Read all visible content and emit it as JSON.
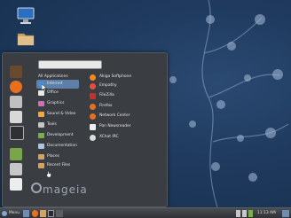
{
  "menu": {
    "search_placeholder": "",
    "header": "All Applications",
    "categories": [
      {
        "label": "Internet",
        "color": "#4a8fd6"
      },
      {
        "label": "Office",
        "color": "#e8e8e8"
      },
      {
        "label": "Graphics",
        "color": "#d16fb5"
      },
      {
        "label": "Sound & Video",
        "color": "#f0a93a"
      },
      {
        "label": "Tools",
        "color": "#c7c7c7"
      },
      {
        "label": "Development",
        "color": "#78b04a"
      },
      {
        "label": "Documentation",
        "color": "#a9c6e6"
      },
      {
        "label": "Places",
        "color": "#d9a25b"
      },
      {
        "label": "Recent Files",
        "color": "#d9a25b"
      }
    ],
    "apps": [
      {
        "label": "Akiga Softphone",
        "color": "#f28a1e"
      },
      {
        "label": "Empathy",
        "color": "#e94e3b"
      },
      {
        "label": "FileZilla",
        "color": "#c7312b"
      },
      {
        "label": "Firefox",
        "color": "#e8701d"
      },
      {
        "label": "Network Center",
        "color": "#e8701d"
      },
      {
        "label": "Pan Newsreader",
        "color": "#ededed"
      },
      {
        "label": "XChat IRC",
        "color": "#dcdcdc"
      }
    ],
    "brand": "mageia"
  },
  "panel": {
    "menu_label": "Menu",
    "clock": "11:13 AM"
  },
  "colors": {
    "accent": "#5d7fa8",
    "menu_bg": "#3a3d42",
    "desktop_bg": "#1f3a5e"
  }
}
